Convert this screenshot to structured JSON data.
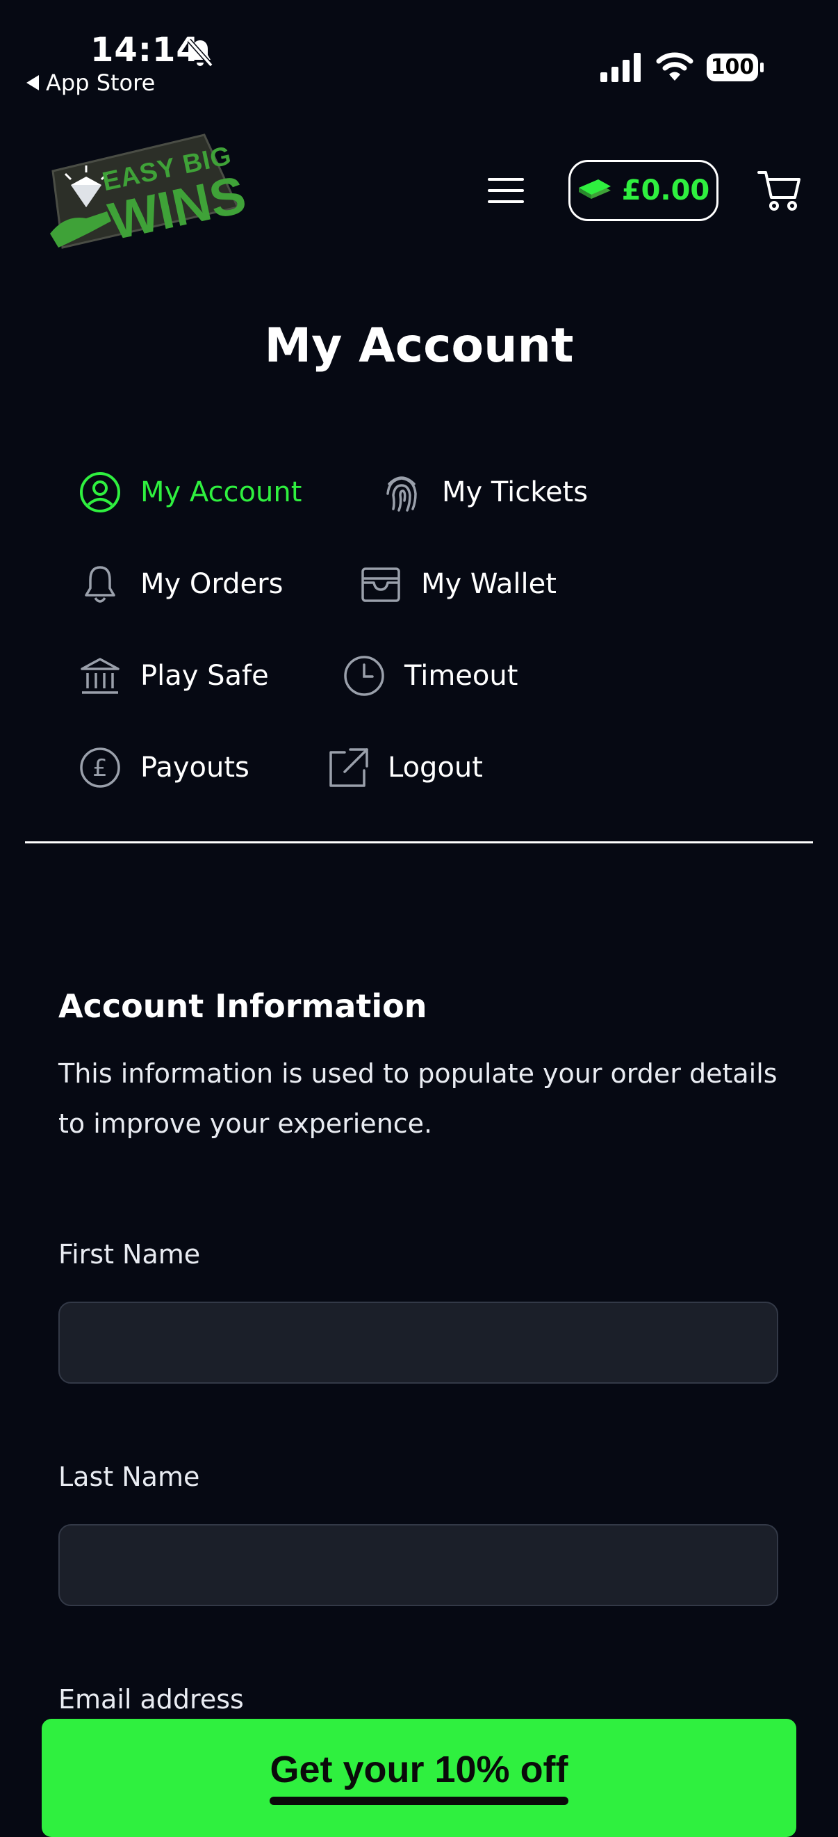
{
  "status_bar": {
    "time": "14:14",
    "back_label": "App Store",
    "battery": "100"
  },
  "header": {
    "logo_text_top": "EASY BIG",
    "logo_text_bottom": "WINS",
    "wallet_balance": "£0.00"
  },
  "page": {
    "title": "My Account"
  },
  "account_nav": {
    "items": [
      {
        "label": "My Account",
        "icon": "user-circle-icon",
        "active": true
      },
      {
        "label": "My Tickets",
        "icon": "fingerprint-icon",
        "active": false
      },
      {
        "label": "My Orders",
        "icon": "bell-icon",
        "active": false
      },
      {
        "label": "My Wallet",
        "icon": "wallet-icon",
        "active": false
      },
      {
        "label": "Play Safe",
        "icon": "bank-icon",
        "active": false
      },
      {
        "label": "Timeout",
        "icon": "clock-icon",
        "active": false
      },
      {
        "label": "Payouts",
        "icon": "pound-circle-icon",
        "active": false
      },
      {
        "label": "Logout",
        "icon": "external-link-icon",
        "active": false
      }
    ]
  },
  "form": {
    "section_title": "Account Information",
    "section_description": "This information is used to populate your order details to improve your experience.",
    "first_name_label": "First Name",
    "first_name_value": "",
    "last_name_label": "Last Name",
    "last_name_value": "",
    "email_label": "Email address"
  },
  "promo": {
    "label": "Get your 10% off"
  },
  "colors": {
    "background": "#060913",
    "accent_green": "#2ff03f",
    "input_background": "#1b1f29",
    "text": "#ffffff"
  }
}
